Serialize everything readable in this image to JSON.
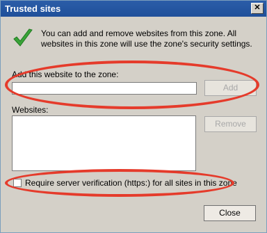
{
  "window": {
    "title": "Trusted sites",
    "close_glyph": "✕"
  },
  "info": {
    "icon": "green-checkmark",
    "text": "You can add and remove websites from this zone. All websites in this zone will use the zone's security settings."
  },
  "add_section": {
    "label": "Add this website to the zone:",
    "value": "",
    "add_button": "Add"
  },
  "websites": {
    "label": "Websites:",
    "items": [],
    "remove_button": "Remove"
  },
  "verification": {
    "label": "Require server verification (https:) for all sites in this zone",
    "checked": false
  },
  "footer": {
    "close_button": "Close"
  },
  "colors": {
    "highlight": "#e53b2b",
    "titlebar": "#2b5da8",
    "dialog_bg": "#d4d0c8"
  }
}
